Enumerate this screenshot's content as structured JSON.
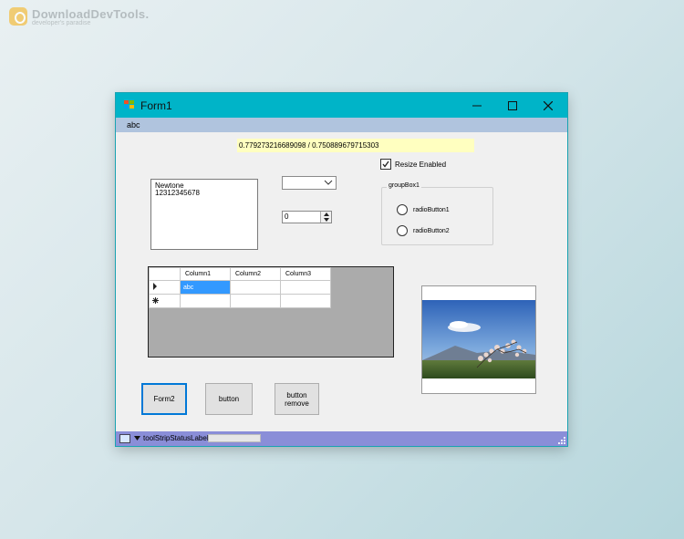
{
  "watermark": {
    "title": "DownloadDevTools.",
    "subtitle": "developer's paradise"
  },
  "window": {
    "title": "Form1",
    "menu": [
      "abc"
    ],
    "label_text": "0.779273216689098 / 0.750889679715303",
    "checkbox": {
      "label": "Resize Enabled",
      "checked": true
    },
    "textbox": {
      "lines": [
        "Newtone",
        "12312345678"
      ]
    },
    "combobox": {
      "value": ""
    },
    "numeric": {
      "value": "0"
    },
    "groupbox": {
      "title": "groupBox1",
      "radios": [
        "radioButton1",
        "radioButton2"
      ]
    },
    "grid": {
      "columns": [
        "Column1",
        "Column2",
        "Column3"
      ],
      "rows": [
        [
          "abc",
          "",
          ""
        ],
        [
          "",
          "",
          ""
        ]
      ],
      "selected_cell": "abc"
    },
    "buttons": {
      "form2": "Form2",
      "button": "button",
      "remove_line1": "button",
      "remove_line2": "remove"
    },
    "status": {
      "label": "toolStripStatusLabel1",
      "progress": 0
    }
  },
  "colors": {
    "titlebar": "#00b4c8",
    "menubar": "#b0c4de",
    "statusbar": "#8a8ed8",
    "label_bg": "#ffffc0",
    "selection": "#3399ff"
  },
  "icons": [
    "minimize-icon",
    "maximize-icon",
    "close-icon",
    "dropdown-arrow-icon",
    "row-pointer-icon",
    "new-row-icon",
    "size-grip-icon"
  ]
}
